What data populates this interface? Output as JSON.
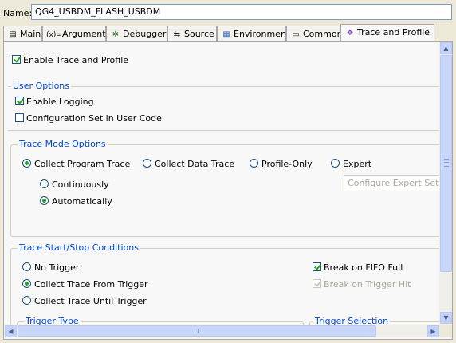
{
  "name": {
    "label": "Name:",
    "value": "QG4_USBDM_FLASH_USBDM"
  },
  "tabs": [
    {
      "label": "Main",
      "icon": "main-icon",
      "glyph": "▤"
    },
    {
      "label": "Arguments",
      "icon": "arguments-icon",
      "glyph": "(x)="
    },
    {
      "label": "Debugger",
      "icon": "debugger-icon",
      "glyph": "✲"
    },
    {
      "label": "Source",
      "icon": "source-icon",
      "glyph": "⇆"
    },
    {
      "label": "Environment",
      "icon": "environment-icon",
      "glyph": "▦"
    },
    {
      "label": "Common",
      "icon": "common-icon",
      "glyph": "▭"
    },
    {
      "label": "Trace and Profile",
      "icon": "trace-icon",
      "glyph": "❖"
    }
  ],
  "enable_trace": {
    "label": "Enable Trace and Profile",
    "checked": true
  },
  "user_options": {
    "title": "User Options",
    "enable_logging": {
      "label": "Enable Logging",
      "checked": true
    },
    "config_set": {
      "label": "Configuration Set in User Code",
      "checked": false
    }
  },
  "trace_mode": {
    "title": "Trace Mode Options",
    "options": [
      "Collect Program Trace",
      "Collect Data Trace",
      "Profile-Only",
      "Expert"
    ],
    "selected": "Collect Program Trace",
    "sub_options": [
      "Continuously",
      "Automatically"
    ],
    "sub_selected": "Automatically",
    "expert_combo": "Configure Expert Settings"
  },
  "trace_start_stop": {
    "title": "Trace Start/Stop Conditions",
    "options": [
      "No Trigger",
      "Collect Trace From Trigger",
      "Collect Trace Until Trigger"
    ],
    "selected": "Collect Trace From Trigger",
    "break_fifo": {
      "label": "Break on FIFO Full",
      "checked": true
    },
    "break_trigger": {
      "label": "Break on Trigger Hit",
      "checked": true,
      "disabled": true
    }
  },
  "trigger_type": {
    "title": "Trigger Type"
  },
  "trigger_selection": {
    "title": "Trigger Selection"
  },
  "colors": {
    "group_label": "#0046d5",
    "check": "#21a121",
    "scroll": "#c8d6fb"
  }
}
